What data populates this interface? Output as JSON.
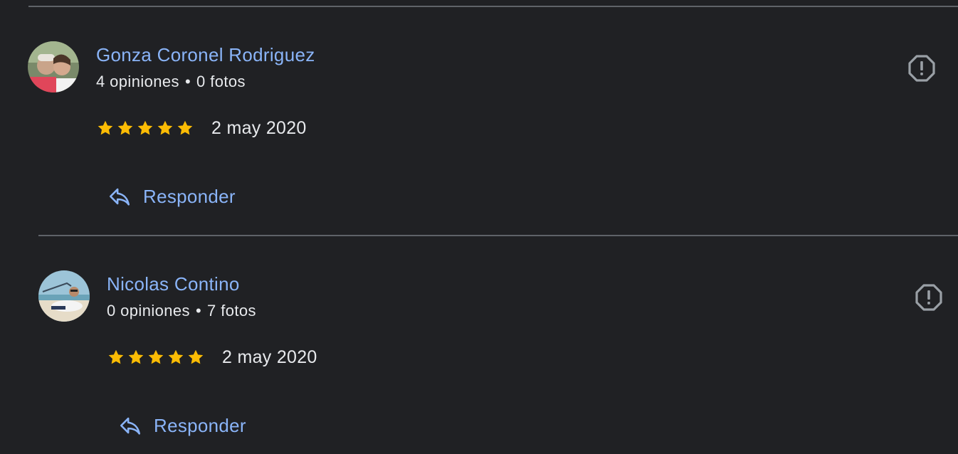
{
  "colors": {
    "background": "#202124",
    "link": "#8ab4f8",
    "text": "#e8eaed",
    "divider": "#5f6368",
    "star": "#fbbc04",
    "icon_gray": "#9aa0a6"
  },
  "reviews": [
    {
      "author": "Gonza Coronel Rodriguez",
      "opinions": "4 opiniones",
      "separator": "•",
      "photos": "0 fotos",
      "rating": 5,
      "date": "2 may 2020",
      "reply_label": "Responder",
      "avatar_icon": "profile-photo",
      "flag_icon": "report-icon"
    },
    {
      "author": "Nicolas Contino",
      "opinions": "0 opiniones",
      "separator": "•",
      "photos": "7 fotos",
      "rating": 5,
      "date": "2 may 2020",
      "reply_label": "Responder",
      "avatar_icon": "profile-photo",
      "flag_icon": "report-icon"
    }
  ]
}
